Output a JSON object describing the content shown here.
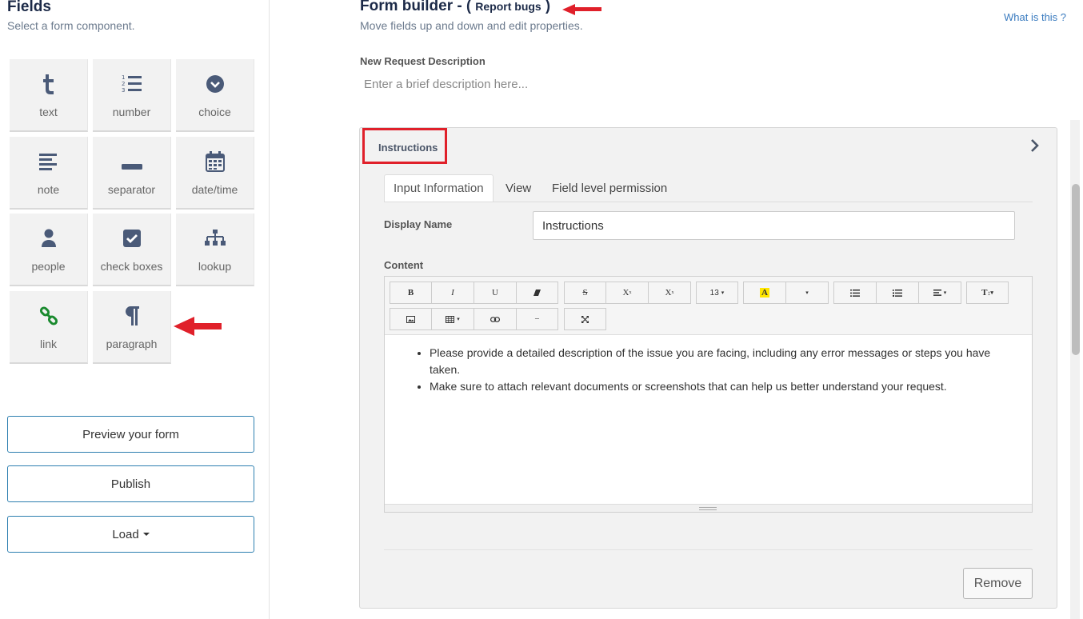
{
  "sidebar": {
    "title": "Fields",
    "subtitle": "Select a form component.",
    "tiles": [
      {
        "label": "text",
        "icon": "text-t-icon"
      },
      {
        "label": "number",
        "icon": "numbered-list-icon"
      },
      {
        "label": "choice",
        "icon": "chevron-circle-icon"
      },
      {
        "label": "note",
        "icon": "align-left-icon"
      },
      {
        "label": "separator",
        "icon": "minus-bar-icon"
      },
      {
        "label": "date/time",
        "icon": "calendar-icon"
      },
      {
        "label": "people",
        "icon": "person-icon"
      },
      {
        "label": "check boxes",
        "icon": "checkbox-icon"
      },
      {
        "label": "lookup",
        "icon": "sitemap-icon"
      },
      {
        "label": "link",
        "icon": "link-icon"
      },
      {
        "label": "paragraph",
        "icon": "pilcrow-icon"
      }
    ],
    "preview_label": "Preview your form",
    "publish_label": "Publish",
    "load_label": "Load"
  },
  "header": {
    "title_prefix": "Form builder - ",
    "paren_open": "(",
    "report_bugs": "Report bugs",
    "paren_close": ")",
    "subtitle": "Move fields up and down and edit properties.",
    "what_link": "What is this ?"
  },
  "description": {
    "label": "New Request Description",
    "placeholder": "Enter a brief description here..."
  },
  "panel": {
    "title": "Instructions",
    "tabs": [
      "Input Information",
      "View",
      "Field level permission"
    ],
    "display_name_label": "Display Name",
    "display_name_value": "Instructions",
    "content_label": "Content",
    "toolbar": {
      "bold": "B",
      "italic": "I",
      "underline": "U",
      "strike": "S",
      "superscript": "X",
      "subscript": "X",
      "font_size": "13",
      "highlight": "A",
      "font_style": "T",
      "hr": "−"
    },
    "content_items": [
      "Please provide a detailed description of the issue you are facing, including any error messages or steps you have taken.",
      "Make sure to attach relevant documents or screenshots that can help us better understand your request."
    ],
    "remove_label": "Remove"
  },
  "colors": {
    "accent": "#2d7fb0",
    "title": "#1c2a48",
    "highlight_box": "#e0202a",
    "link_icon": "#1a8a2e"
  }
}
